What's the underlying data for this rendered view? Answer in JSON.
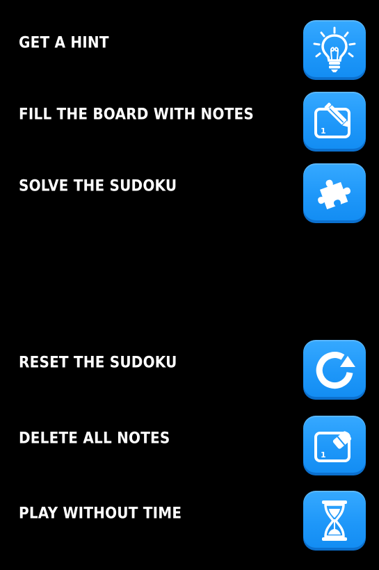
{
  "colors": {
    "background": "#000000",
    "text": "#ffffff",
    "button": "#1e97f9"
  },
  "menu": {
    "hint": {
      "label": "GET A HINT",
      "icon": "lightbulb-icon"
    },
    "fill_notes": {
      "label": "FILL THE BOARD WITH NOTES",
      "icon": "pencil-note-icon"
    },
    "solve": {
      "label": "SOLVE THE SUDOKU",
      "icon": "puzzle-piece-icon"
    },
    "reset": {
      "label": "RESET THE SUDOKU",
      "icon": "reset-arrow-icon"
    },
    "delete_notes": {
      "label": "DELETE ALL NOTES",
      "icon": "eraser-note-icon"
    },
    "no_time": {
      "label": "PLAY WITHOUT TIME",
      "icon": "hourglass-icon"
    }
  },
  "icon_glyphs": {
    "note_digit": "1"
  }
}
